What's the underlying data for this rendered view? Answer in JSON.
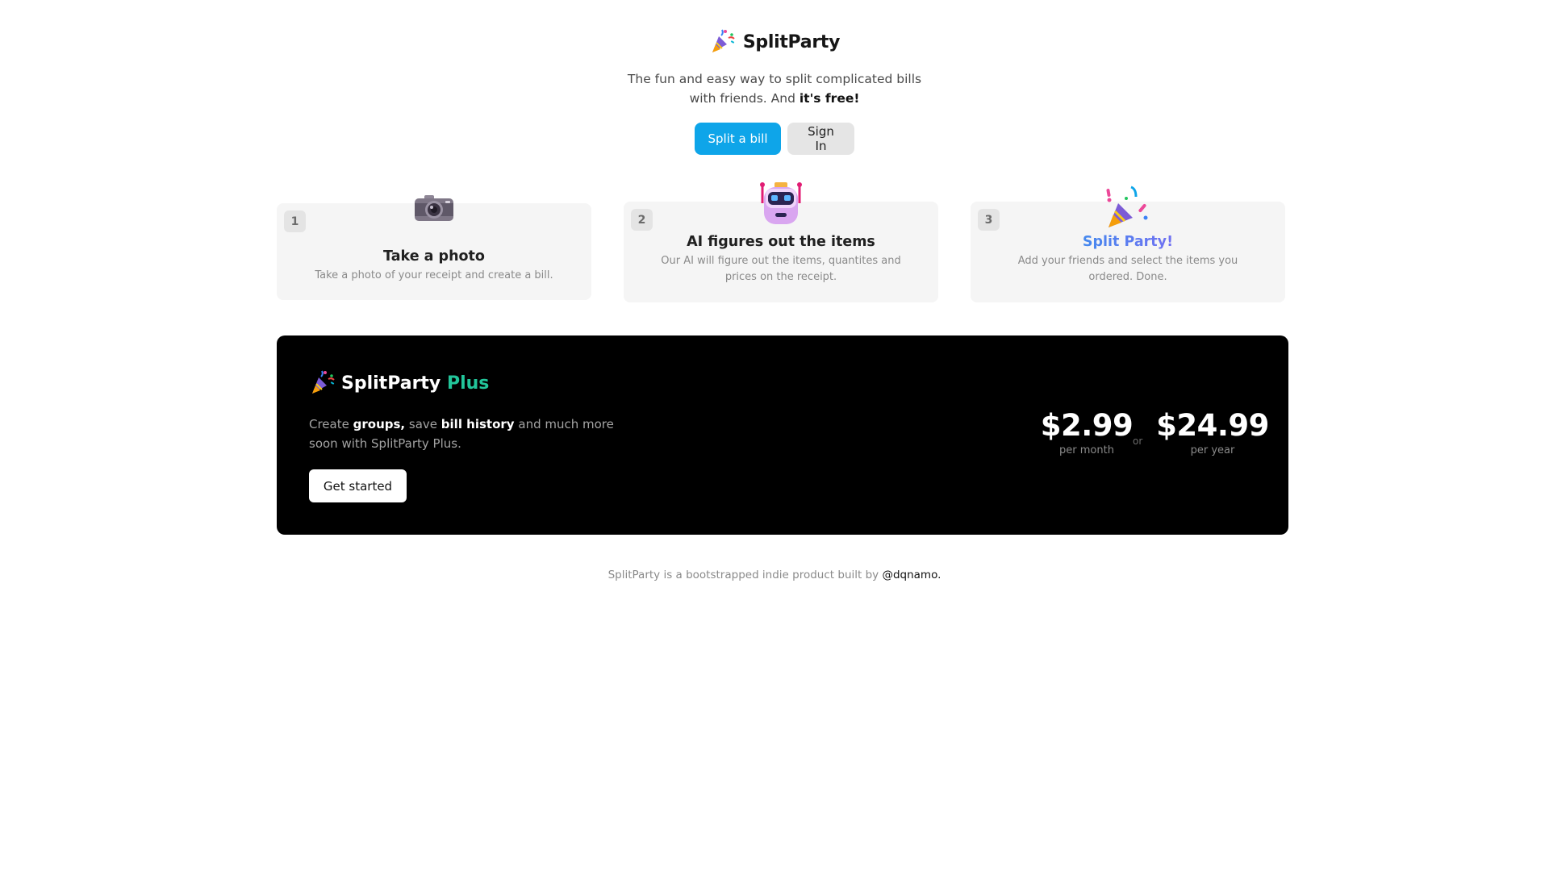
{
  "header": {
    "brand_name": "SplitParty",
    "tagline_line1": "The fun and easy way to split complicated bills",
    "tagline_line2_prefix": "with friends. And",
    "tagline_emphasis": "it's free!",
    "primary_button": "Split a bill",
    "secondary_button": "Sign In",
    "brand_icon": "party-popper-icon"
  },
  "steps": [
    {
      "number": "1",
      "title": "Take a photo",
      "description": "Take a photo of your receipt and create a bill.",
      "icon": "camera-icon"
    },
    {
      "number": "2",
      "title": "AI figures out the items",
      "description": "Our AI will figure out the items, quantites and prices on the receipt.",
      "icon": "robot-icon"
    },
    {
      "number": "3",
      "title": "Split Party!",
      "description": "Add your friends and select the items you ordered. Done.",
      "icon": "party-popper-icon"
    }
  ],
  "plus": {
    "brand_name": "SplitParty",
    "brand_accent": "Plus",
    "desc_create": "Create",
    "desc_groups": "groups,",
    "desc_save": "save",
    "desc_history": "bill history",
    "desc_rest": "and much more soon with SplitParty Plus.",
    "cta": "Get started",
    "monthly_price": "$2.99",
    "monthly_period": "per month",
    "or_label": "or",
    "yearly_price": "$24.99",
    "yearly_period": "per year"
  },
  "footer": {
    "text": "SplitParty is a bootstrapped indie product built by",
    "link": "@dqnamo."
  },
  "colors": {
    "primary": "#0ea5e9",
    "plus_accent": "#22c59a",
    "card_bg": "#f5f5f5",
    "banner_bg": "#000000"
  }
}
